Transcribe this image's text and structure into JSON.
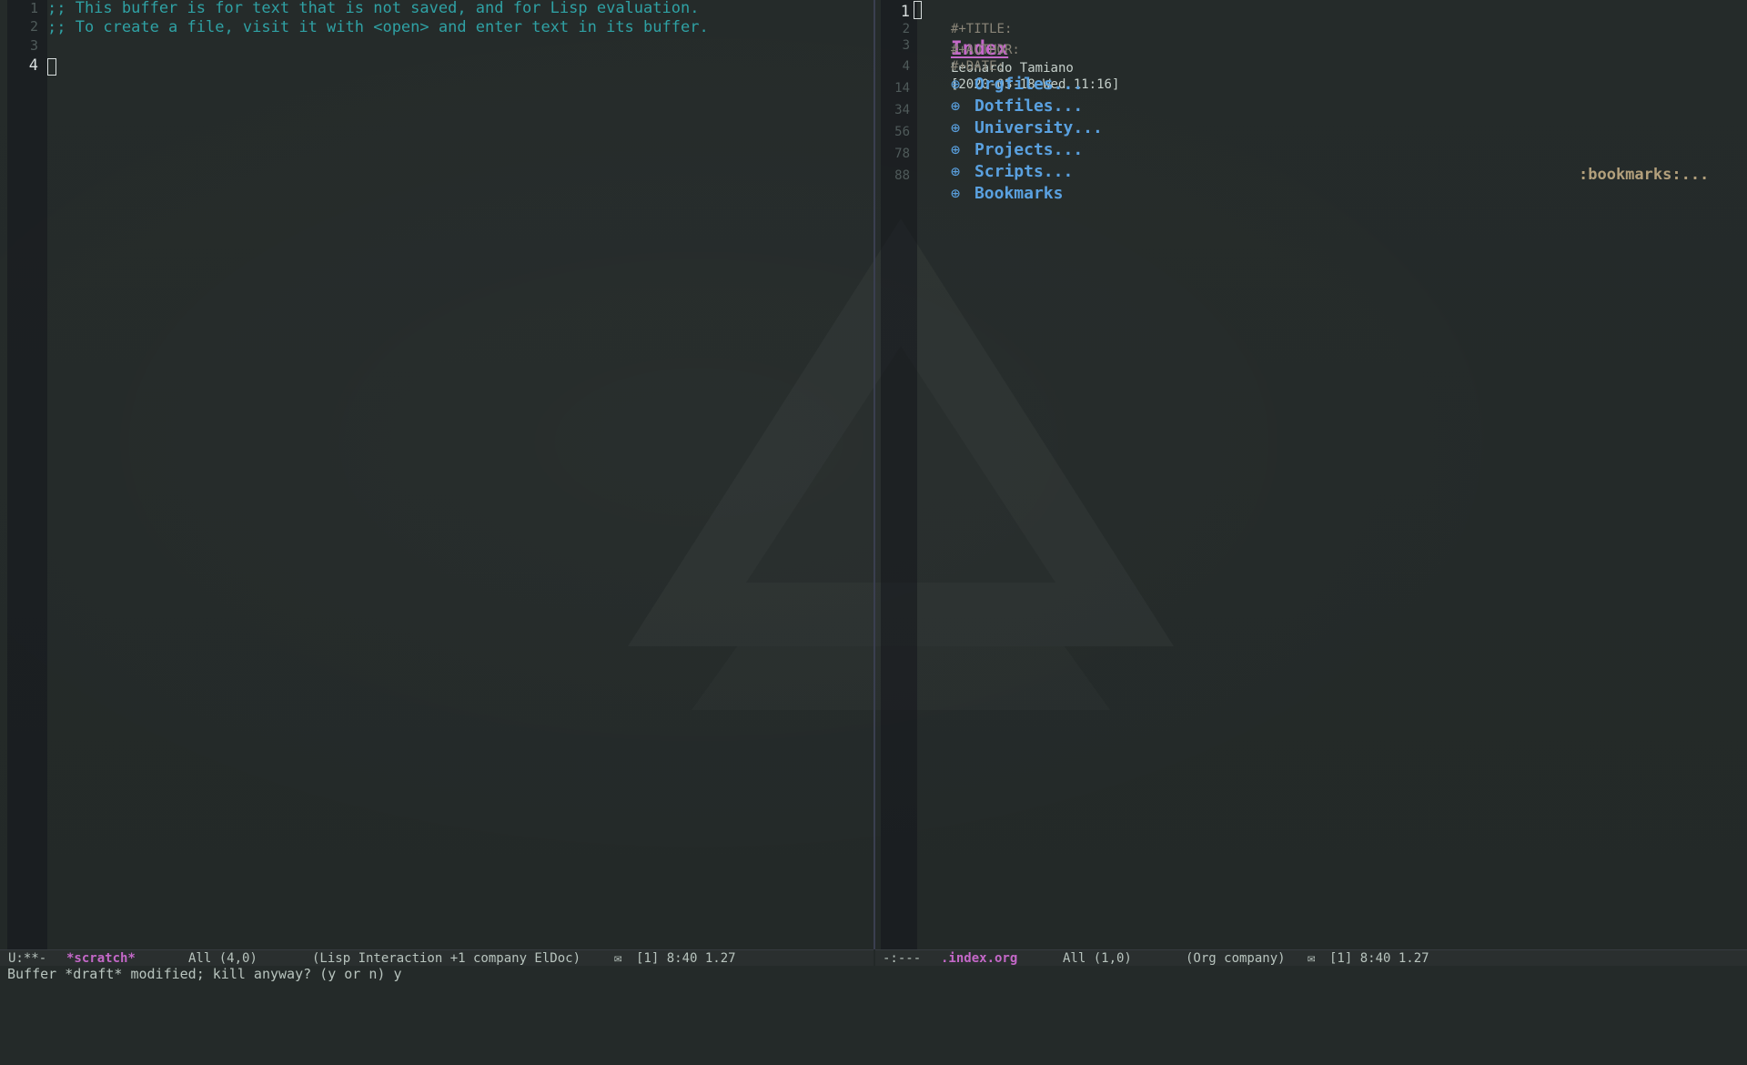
{
  "left_window": {
    "line_numbers": [
      "1",
      "2",
      "3",
      "4"
    ],
    "lines": [
      ";; This buffer is for text that is not saved, and for Lisp evaluation.",
      ";; To create a file, visit it with <open> and enter text in its buffer.",
      "",
      ""
    ]
  },
  "right_window": {
    "line_numbers": [
      "1",
      "2",
      "3",
      "4",
      "14",
      "34",
      "56",
      "78",
      "88"
    ],
    "title_key": "#+TITLE:",
    "title_value": "Index",
    "author_key": "#+AUTHOR:",
    "author_value": "Leonardo Tamiano",
    "date_key": "#+DATE:",
    "date_value": "[2020-03-18 Wed 11:16]",
    "bullet_glyph": "⊕",
    "headings": [
      "Orgfiles...",
      "Dotfiles...",
      "University...",
      "Projects...",
      "Scripts...",
      "Bookmarks"
    ],
    "bookmarks_tag": ":bookmarks:..."
  },
  "modeline_left": {
    "status": "U:**-",
    "buffer": "*scratch*",
    "position": "All (4,0)",
    "modes": "(Lisp Interaction +1 company ElDoc)",
    "mail_icon": "mail-icon",
    "extra": "[1] 8:40 1.27"
  },
  "modeline_right": {
    "status": "-:---",
    "buffer": ".index.org",
    "position": "All (1,0)",
    "modes": "(Org company)",
    "mail_icon": "mail-icon",
    "extra": "[1] 8:40 1.27"
  },
  "echo_area": "Buffer *draft* modified; kill anyway? (y or n) y",
  "colors": {
    "background": "#242a29",
    "comment": "#2fa1a4",
    "heading": "#5aa1e0",
    "title": "#c468c8",
    "tag": "#b3a07c"
  }
}
